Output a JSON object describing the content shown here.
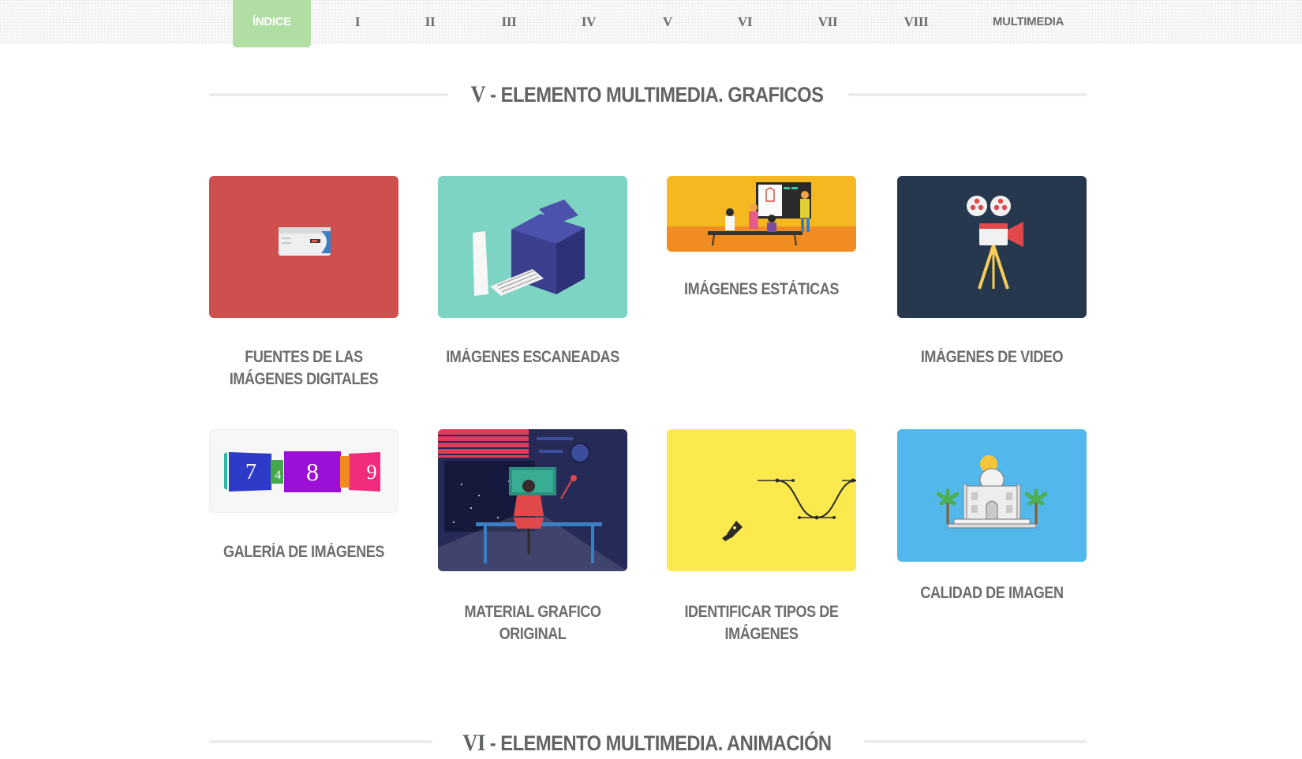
{
  "nav": {
    "items": [
      {
        "label": "ÍNDICE",
        "active": true
      },
      {
        "label": "I"
      },
      {
        "label": "II"
      },
      {
        "label": "III"
      },
      {
        "label": "IV"
      },
      {
        "label": "V"
      },
      {
        "label": "VI"
      },
      {
        "label": "VII"
      },
      {
        "label": "VIII"
      },
      {
        "label": "MULTIMEDIA"
      }
    ]
  },
  "section_v": {
    "number": "V",
    "title": "- ELEMENTO MULTIMEDIA. GRAFICOS"
  },
  "section_vi": {
    "number": "VI",
    "title": "- ELEMENTO MULTIMEDIA. ANIMACIÓN"
  },
  "cards": [
    {
      "label": "FUENTES DE LAS IMÁGENES DIGITALES",
      "icon": "camera-icon",
      "color": "#cd4f4e"
    },
    {
      "label": "IMÁGENES ESCANEADAS",
      "icon": "printer-icon",
      "color": "#7dd4c4"
    },
    {
      "label": "IMÁGENES ESTÁTICAS",
      "icon": "classroom-icon",
      "color": "#f6b820"
    },
    {
      "label": "IMÁGENES DE VIDEO",
      "icon": "film-projector-icon",
      "color": "#27384e"
    },
    {
      "label": "GALERÍA DE IMÁGENES",
      "icon": "gallery-slider-icon",
      "color": "#f7f7f7"
    },
    {
      "label": "MATERIAL GRAFICO ORIGINAL",
      "icon": "designer-desk-icon",
      "color": "#262a57"
    },
    {
      "label": "IDENTIFICAR TIPOS DE IMÁGENES",
      "icon": "pen-tool-icon",
      "color": "#fbe94e"
    },
    {
      "label": "CALIDAD DE IMAGEN",
      "icon": "taj-mahal-icon",
      "color": "#52b8ec"
    }
  ],
  "gallery": {
    "left_number": "7",
    "center_number": "8",
    "right_number": "9",
    "small_number": "4"
  }
}
